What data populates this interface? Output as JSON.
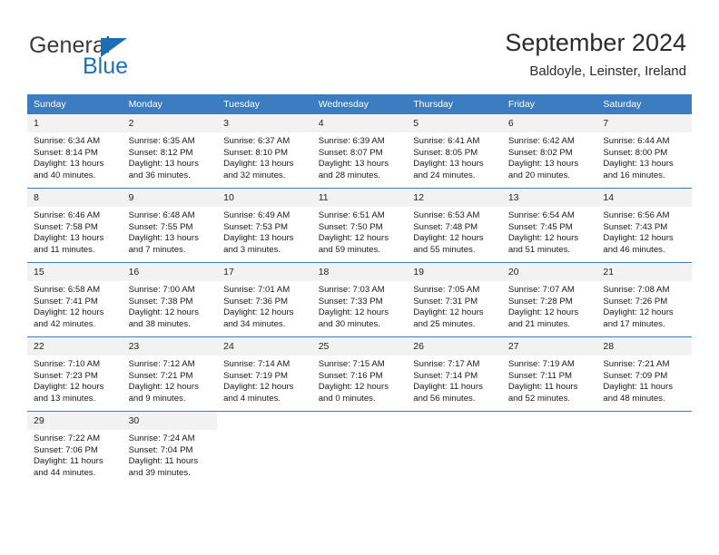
{
  "brand": {
    "name_top": "General",
    "name_bottom": "Blue",
    "triangle_color": "#1b6fb5",
    "text_color": "#3b3b3b",
    "blue_color": "#1b72ba"
  },
  "header": {
    "title": "September 2024",
    "subtitle": "Baldoyle, Leinster, Ireland"
  },
  "theme": {
    "header_bg": "#3b7dc0",
    "header_text": "#ffffff",
    "daynum_bg": "#f2f2f2",
    "row_border": "#3b7dc0"
  },
  "weekdays": [
    "Sunday",
    "Monday",
    "Tuesday",
    "Wednesday",
    "Thursday",
    "Friday",
    "Saturday"
  ],
  "weeks": [
    [
      {
        "day": "1",
        "sunrise": "Sunrise: 6:34 AM",
        "sunset": "Sunset: 8:14 PM",
        "daylight1": "Daylight: 13 hours",
        "daylight2": "and 40 minutes."
      },
      {
        "day": "2",
        "sunrise": "Sunrise: 6:35 AM",
        "sunset": "Sunset: 8:12 PM",
        "daylight1": "Daylight: 13 hours",
        "daylight2": "and 36 minutes."
      },
      {
        "day": "3",
        "sunrise": "Sunrise: 6:37 AM",
        "sunset": "Sunset: 8:10 PM",
        "daylight1": "Daylight: 13 hours",
        "daylight2": "and 32 minutes."
      },
      {
        "day": "4",
        "sunrise": "Sunrise: 6:39 AM",
        "sunset": "Sunset: 8:07 PM",
        "daylight1": "Daylight: 13 hours",
        "daylight2": "and 28 minutes."
      },
      {
        "day": "5",
        "sunrise": "Sunrise: 6:41 AM",
        "sunset": "Sunset: 8:05 PM",
        "daylight1": "Daylight: 13 hours",
        "daylight2": "and 24 minutes."
      },
      {
        "day": "6",
        "sunrise": "Sunrise: 6:42 AM",
        "sunset": "Sunset: 8:02 PM",
        "daylight1": "Daylight: 13 hours",
        "daylight2": "and 20 minutes."
      },
      {
        "day": "7",
        "sunrise": "Sunrise: 6:44 AM",
        "sunset": "Sunset: 8:00 PM",
        "daylight1": "Daylight: 13 hours",
        "daylight2": "and 16 minutes."
      }
    ],
    [
      {
        "day": "8",
        "sunrise": "Sunrise: 6:46 AM",
        "sunset": "Sunset: 7:58 PM",
        "daylight1": "Daylight: 13 hours",
        "daylight2": "and 11 minutes."
      },
      {
        "day": "9",
        "sunrise": "Sunrise: 6:48 AM",
        "sunset": "Sunset: 7:55 PM",
        "daylight1": "Daylight: 13 hours",
        "daylight2": "and 7 minutes."
      },
      {
        "day": "10",
        "sunrise": "Sunrise: 6:49 AM",
        "sunset": "Sunset: 7:53 PM",
        "daylight1": "Daylight: 13 hours",
        "daylight2": "and 3 minutes."
      },
      {
        "day": "11",
        "sunrise": "Sunrise: 6:51 AM",
        "sunset": "Sunset: 7:50 PM",
        "daylight1": "Daylight: 12 hours",
        "daylight2": "and 59 minutes."
      },
      {
        "day": "12",
        "sunrise": "Sunrise: 6:53 AM",
        "sunset": "Sunset: 7:48 PM",
        "daylight1": "Daylight: 12 hours",
        "daylight2": "and 55 minutes."
      },
      {
        "day": "13",
        "sunrise": "Sunrise: 6:54 AM",
        "sunset": "Sunset: 7:45 PM",
        "daylight1": "Daylight: 12 hours",
        "daylight2": "and 51 minutes."
      },
      {
        "day": "14",
        "sunrise": "Sunrise: 6:56 AM",
        "sunset": "Sunset: 7:43 PM",
        "daylight1": "Daylight: 12 hours",
        "daylight2": "and 46 minutes."
      }
    ],
    [
      {
        "day": "15",
        "sunrise": "Sunrise: 6:58 AM",
        "sunset": "Sunset: 7:41 PM",
        "daylight1": "Daylight: 12 hours",
        "daylight2": "and 42 minutes."
      },
      {
        "day": "16",
        "sunrise": "Sunrise: 7:00 AM",
        "sunset": "Sunset: 7:38 PM",
        "daylight1": "Daylight: 12 hours",
        "daylight2": "and 38 minutes."
      },
      {
        "day": "17",
        "sunrise": "Sunrise: 7:01 AM",
        "sunset": "Sunset: 7:36 PM",
        "daylight1": "Daylight: 12 hours",
        "daylight2": "and 34 minutes."
      },
      {
        "day": "18",
        "sunrise": "Sunrise: 7:03 AM",
        "sunset": "Sunset: 7:33 PM",
        "daylight1": "Daylight: 12 hours",
        "daylight2": "and 30 minutes."
      },
      {
        "day": "19",
        "sunrise": "Sunrise: 7:05 AM",
        "sunset": "Sunset: 7:31 PM",
        "daylight1": "Daylight: 12 hours",
        "daylight2": "and 25 minutes."
      },
      {
        "day": "20",
        "sunrise": "Sunrise: 7:07 AM",
        "sunset": "Sunset: 7:28 PM",
        "daylight1": "Daylight: 12 hours",
        "daylight2": "and 21 minutes."
      },
      {
        "day": "21",
        "sunrise": "Sunrise: 7:08 AM",
        "sunset": "Sunset: 7:26 PM",
        "daylight1": "Daylight: 12 hours",
        "daylight2": "and 17 minutes."
      }
    ],
    [
      {
        "day": "22",
        "sunrise": "Sunrise: 7:10 AM",
        "sunset": "Sunset: 7:23 PM",
        "daylight1": "Daylight: 12 hours",
        "daylight2": "and 13 minutes."
      },
      {
        "day": "23",
        "sunrise": "Sunrise: 7:12 AM",
        "sunset": "Sunset: 7:21 PM",
        "daylight1": "Daylight: 12 hours",
        "daylight2": "and 9 minutes."
      },
      {
        "day": "24",
        "sunrise": "Sunrise: 7:14 AM",
        "sunset": "Sunset: 7:19 PM",
        "daylight1": "Daylight: 12 hours",
        "daylight2": "and 4 minutes."
      },
      {
        "day": "25",
        "sunrise": "Sunrise: 7:15 AM",
        "sunset": "Sunset: 7:16 PM",
        "daylight1": "Daylight: 12 hours",
        "daylight2": "and 0 minutes."
      },
      {
        "day": "26",
        "sunrise": "Sunrise: 7:17 AM",
        "sunset": "Sunset: 7:14 PM",
        "daylight1": "Daylight: 11 hours",
        "daylight2": "and 56 minutes."
      },
      {
        "day": "27",
        "sunrise": "Sunrise: 7:19 AM",
        "sunset": "Sunset: 7:11 PM",
        "daylight1": "Daylight: 11 hours",
        "daylight2": "and 52 minutes."
      },
      {
        "day": "28",
        "sunrise": "Sunrise: 7:21 AM",
        "sunset": "Sunset: 7:09 PM",
        "daylight1": "Daylight: 11 hours",
        "daylight2": "and 48 minutes."
      }
    ],
    [
      {
        "day": "29",
        "sunrise": "Sunrise: 7:22 AM",
        "sunset": "Sunset: 7:06 PM",
        "daylight1": "Daylight: 11 hours",
        "daylight2": "and 44 minutes."
      },
      {
        "day": "30",
        "sunrise": "Sunrise: 7:24 AM",
        "sunset": "Sunset: 7:04 PM",
        "daylight1": "Daylight: 11 hours",
        "daylight2": "and 39 minutes."
      },
      {
        "day": "",
        "sunrise": "",
        "sunset": "",
        "daylight1": "",
        "daylight2": ""
      },
      {
        "day": "",
        "sunrise": "",
        "sunset": "",
        "daylight1": "",
        "daylight2": ""
      },
      {
        "day": "",
        "sunrise": "",
        "sunset": "",
        "daylight1": "",
        "daylight2": ""
      },
      {
        "day": "",
        "sunrise": "",
        "sunset": "",
        "daylight1": "",
        "daylight2": ""
      },
      {
        "day": "",
        "sunrise": "",
        "sunset": "",
        "daylight1": "",
        "daylight2": ""
      }
    ]
  ]
}
